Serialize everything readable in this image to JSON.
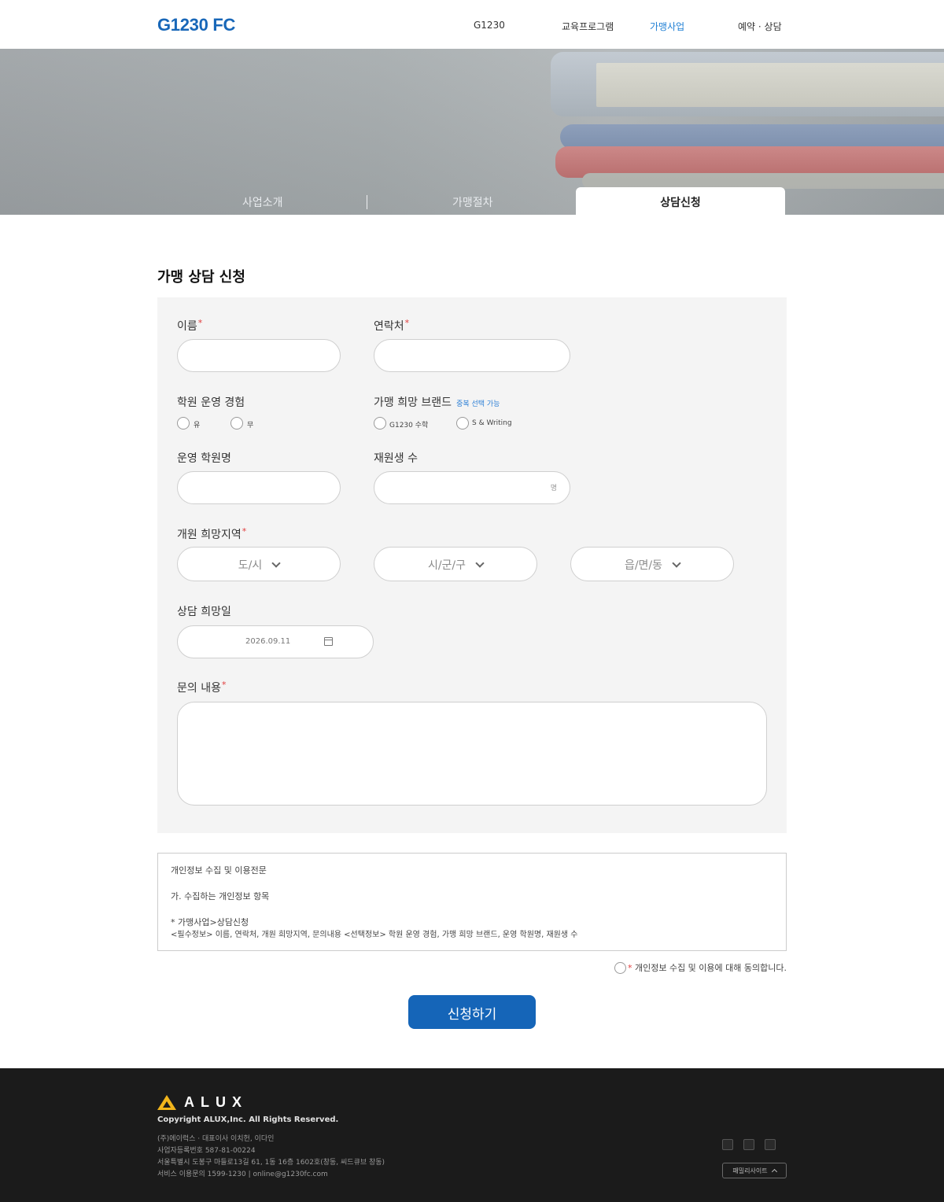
{
  "header": {
    "logo": "G1230 FC",
    "nav": [
      "G1230",
      "교육프로그램",
      "가맹사업",
      "예약 · 상담"
    ],
    "active_nav": "가맹사업"
  },
  "hero": {
    "tabs": [
      "사업소개",
      "가맹절차",
      "상담신청"
    ],
    "active_tab": "상담신청"
  },
  "form": {
    "title": "가맹 상담 신청",
    "name_label": "이름",
    "phone_label": "연락처",
    "required_mark": "*",
    "experience_label": "학원 운영 경험",
    "experience_options": [
      "유",
      "무"
    ],
    "brand_label": "가맹 희망 브랜드",
    "brand_hint": "중복 선택 가능",
    "brand_options": [
      "G1230 수학",
      "S & Writing"
    ],
    "academy_name_label": "운영 학원명",
    "students_label": "재원생 수",
    "students_unit": "명",
    "region_label": "개원 희망지역",
    "region_selects": [
      "도/시",
      "시/군/구",
      "읍/면/동"
    ],
    "date_label": "상담 희망일",
    "date_value": "2026.09.11",
    "inquiry_label": "문의 내용"
  },
  "privacy": {
    "lines": [
      "개인정보 수집 및 이용전문",
      "가. 수집하는 개인정보 항목",
      "* 가맹사업>상담신청",
      "<필수정보> 이름, 연락처, 개원 희망지역, 문의내용 <선택정보> 학원 운영 경험, 가맹 희망 브랜드, 운영 학원명, 재원생 수"
    ],
    "agree_mark": "*",
    "agree_text": "개인정보 수집 및 이용에 대해 동의합니다."
  },
  "submit_label": "신청하기",
  "footer": {
    "logo_text": "ALUX",
    "copyright": "Copyright ALUX,Inc. All Rights Reserved.",
    "company": "(주)에이럭스 · 대표이사 이치헌, 이다인",
    "business_no": "사업자등록번호 587-81-00224",
    "address": "서울특별시 도봉구 마들로13길 61, 1동 16층 1602호(창동, 씨드큐브 창동)",
    "contact": "서비스 이용문의 1599-1230  |  online@g1230fc.com",
    "family_site": "패밀리사이트"
  },
  "colors": {
    "brand": "#1867b8",
    "accent": "#1f7fd4",
    "submit": "#1565b8",
    "required": "#e03c3c"
  }
}
